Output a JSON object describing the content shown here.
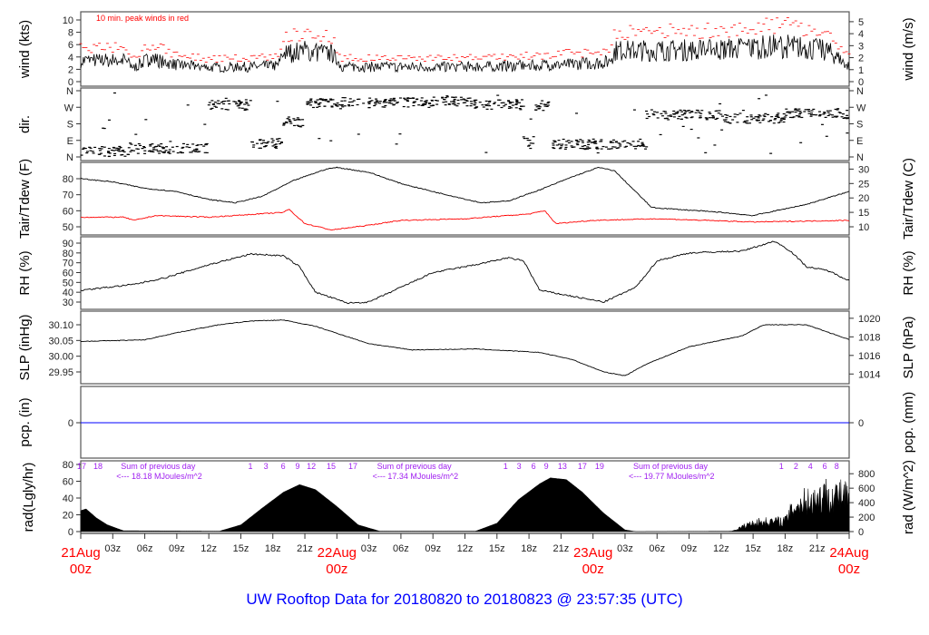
{
  "title": "UW Rooftop Data for 20180820  to  20180823 @ 23:57:35  (UTC)",
  "colors": {
    "title": "#0000ff",
    "peak": "#ff0000",
    "dew": "#ff0000",
    "pcp": "#0000ff",
    "day_label": "#ff0000",
    "rad_annot": "#a020f0"
  },
  "x_axis": {
    "start": "2018-08-21T00:00",
    "end": "2018-08-24T00:00",
    "hour_ticks": [
      "03z",
      "06z",
      "09z",
      "12z",
      "15z",
      "18z",
      "21z"
    ],
    "day_labels": [
      {
        "day": "21Aug",
        "hour": "00z"
      },
      {
        "day": "22Aug",
        "hour": "00z"
      },
      {
        "day": "23Aug",
        "hour": "00z"
      },
      {
        "day": "24Aug",
        "hour": "00z"
      }
    ]
  },
  "chart_data": [
    {
      "type": "line",
      "id": "wind",
      "ylabel": "wind (kts)",
      "ylabel_right": "wind (m/s)",
      "ylim": [
        0,
        10.5
      ],
      "yticks": [
        "0",
        "2",
        "4",
        "6",
        "8",
        "10"
      ],
      "yticks_right": [
        "0",
        "1",
        "2",
        "3",
        "4",
        "5"
      ],
      "annotation": "10 min. peak winds in red",
      "series": [
        {
          "role": "mean",
          "color": "#000000",
          "points": [
            [
              "2018-08-21T00:00",
              3.4
            ],
            [
              "2018-08-21T04:00",
              3.5
            ],
            [
              "2018-08-21T05:00",
              2.3
            ],
            [
              "2018-08-21T06:30",
              3.8
            ],
            [
              "2018-08-21T09:00",
              2.7
            ],
            [
              "2018-08-21T12:00",
              2.3
            ],
            [
              "2018-08-21T16:00",
              2.4
            ],
            [
              "2018-08-21T18:30",
              2.6
            ],
            [
              "2018-08-21T19:00",
              4.5
            ],
            [
              "2018-08-21T21:00",
              5.0
            ],
            [
              "2018-08-21T23:30",
              4.5
            ],
            [
              "2018-08-22T00:30",
              2.4
            ],
            [
              "2018-08-22T12:00",
              2.4
            ],
            [
              "2018-08-22T18:00",
              2.6
            ],
            [
              "2018-08-23T00:00",
              3.0
            ],
            [
              "2018-08-23T01:30",
              3.2
            ],
            [
              "2018-08-23T02:00",
              5.0
            ],
            [
              "2018-08-23T12:00",
              5.2
            ],
            [
              "2018-08-23T18:00",
              5.8
            ],
            [
              "2018-08-23T22:00",
              5.0
            ],
            [
              "2018-08-24T00:00",
              2.5
            ]
          ]
        },
        {
          "role": "10 min peak",
          "color": "#ff0000"
        }
      ]
    },
    {
      "type": "scatter",
      "id": "dir",
      "ylabel": "dir.",
      "yticks": [
        "N",
        "E",
        "S",
        "W",
        "N"
      ],
      "segments": [
        [
          "2018-08-21T00:00",
          "2018-08-21T04:30",
          30
        ],
        [
          "2018-08-21T04:30",
          "2018-08-21T05:30",
          45
        ],
        [
          "2018-08-21T05:30",
          "2018-08-21T12:00",
          45
        ],
        [
          "2018-08-21T12:00",
          "2018-08-21T16:00",
          280
        ],
        [
          "2018-08-21T16:00",
          "2018-08-21T19:00",
          75
        ],
        [
          "2018-08-21T19:00",
          "2018-08-21T21:00",
          190
        ],
        [
          "2018-08-21T21:00",
          "2018-08-22T09:00",
          295
        ],
        [
          "2018-08-22T09:00",
          "2018-08-22T12:30",
          305
        ],
        [
          "2018-08-22T12:30",
          "2018-08-22T14:00",
          290
        ],
        [
          "2018-08-22T14:00",
          "2018-08-22T17:30",
          285
        ],
        [
          "2018-08-22T17:30",
          "2018-08-22T18:30",
          85
        ],
        [
          "2018-08-22T18:30",
          "2018-08-22T20:00",
          280
        ],
        [
          "2018-08-22T20:00",
          "2018-08-23T05:00",
          70
        ],
        [
          "2018-08-23T05:00",
          "2018-08-23T12:00",
          230
        ],
        [
          "2018-08-23T12:00",
          "2018-08-23T18:00",
          210
        ],
        [
          "2018-08-23T18:00",
          "2018-08-24T00:00",
          235
        ]
      ]
    },
    {
      "type": "line",
      "id": "temp",
      "ylabel": "Tair/Tdew (F)",
      "ylabel_right": "Tair/Tdew (C)",
      "yticks": [
        "50",
        "60",
        "70",
        "80"
      ],
      "yticks_right": [
        "10",
        "15",
        "20",
        "25",
        "30"
      ],
      "series": [
        {
          "name": "Tair",
          "color": "#000000",
          "points": [
            [
              "2018-08-21T00:00",
              80
            ],
            [
              "2018-08-21T03:00",
              78
            ],
            [
              "2018-08-21T06:00",
              74
            ],
            [
              "2018-08-21T09:00",
              72
            ],
            [
              "2018-08-21T12:00",
              67
            ],
            [
              "2018-08-21T14:30",
              65
            ],
            [
              "2018-08-21T17:00",
              69
            ],
            [
              "2018-08-21T20:00",
              79
            ],
            [
              "2018-08-21T23:00",
              86
            ],
            [
              "2018-08-22T00:00",
              87
            ],
            [
              "2018-08-22T03:00",
              84
            ],
            [
              "2018-08-22T06:00",
              77
            ],
            [
              "2018-08-22T09:00",
              72
            ],
            [
              "2018-08-22T13:30",
              65
            ],
            [
              "2018-08-22T16:00",
              66
            ],
            [
              "2018-08-22T19:00",
              73
            ],
            [
              "2018-08-22T22:00",
              81
            ],
            [
              "2018-08-23T00:30",
              87
            ],
            [
              "2018-08-23T02:00",
              85
            ],
            [
              "2018-08-23T05:30",
              62
            ],
            [
              "2018-08-23T12:00",
              59
            ],
            [
              "2018-08-23T15:00",
              57
            ],
            [
              "2018-08-23T20:00",
              64
            ],
            [
              "2018-08-24T00:00",
              72
            ]
          ]
        },
        {
          "name": "Tdew",
          "color": "#ff0000",
          "points": [
            [
              "2018-08-21T00:00",
              56
            ],
            [
              "2018-08-21T04:00",
              56
            ],
            [
              "2018-08-21T05:00",
              54
            ],
            [
              "2018-08-21T07:00",
              57
            ],
            [
              "2018-08-21T12:00",
              56
            ],
            [
              "2018-08-21T19:00",
              59
            ],
            [
              "2018-08-21T19:30",
              61
            ],
            [
              "2018-08-21T21:00",
              52
            ],
            [
              "2018-08-21T23:30",
              48
            ],
            [
              "2018-08-22T03:00",
              51
            ],
            [
              "2018-08-22T06:00",
              54
            ],
            [
              "2018-08-22T12:00",
              55
            ],
            [
              "2018-08-22T18:00",
              58
            ],
            [
              "2018-08-22T19:30",
              60
            ],
            [
              "2018-08-22T20:30",
              52
            ],
            [
              "2018-08-23T00:00",
              54
            ],
            [
              "2018-08-23T06:00",
              55
            ],
            [
              "2018-08-23T15:00",
              53
            ],
            [
              "2018-08-24T00:00",
              54
            ]
          ]
        }
      ]
    },
    {
      "type": "line",
      "id": "rh",
      "ylabel": "RH (%)",
      "ylabel_right": "RH (%)",
      "yticks": [
        "30",
        "40",
        "50",
        "60",
        "70",
        "80",
        "90"
      ],
      "series": [
        {
          "color": "#000000",
          "points": [
            [
              "2018-08-21T00:00",
              42
            ],
            [
              "2018-08-21T05:00",
              48
            ],
            [
              "2018-08-21T08:00",
              55
            ],
            [
              "2018-08-21T12:00",
              68
            ],
            [
              "2018-08-21T16:00",
              79
            ],
            [
              "2018-08-21T19:00",
              77
            ],
            [
              "2018-08-21T20:30",
              66
            ],
            [
              "2018-08-21T22:00",
              40
            ],
            [
              "2018-08-22T01:00",
              29
            ],
            [
              "2018-08-22T03:00",
              30
            ],
            [
              "2018-08-22T06:00",
              45
            ],
            [
              "2018-08-22T09:00",
              60
            ],
            [
              "2018-08-22T13:00",
              68
            ],
            [
              "2018-08-22T16:00",
              75
            ],
            [
              "2018-08-22T17:30",
              72
            ],
            [
              "2018-08-22T19:00",
              42
            ],
            [
              "2018-08-22T21:00",
              38
            ],
            [
              "2018-08-23T01:00",
              30
            ],
            [
              "2018-08-23T04:00",
              45
            ],
            [
              "2018-08-23T06:00",
              72
            ],
            [
              "2018-08-23T09:00",
              80
            ],
            [
              "2018-08-23T14:00",
              82
            ],
            [
              "2018-08-23T17:00",
              92
            ],
            [
              "2018-08-23T18:30",
              82
            ],
            [
              "2018-08-23T20:00",
              66
            ],
            [
              "2018-08-23T22:00",
              62
            ],
            [
              "2018-08-24T00:00",
              52
            ]
          ]
        }
      ]
    },
    {
      "type": "line",
      "id": "slp",
      "ylabel": "SLP (inHg)",
      "ylabel_right": "SLP (hPa)",
      "yticks": [
        "29.95",
        "30.00",
        "30.05",
        "30.10"
      ],
      "yticks_right": [
        "1014",
        "1016",
        "1018",
        "1020"
      ],
      "series": [
        {
          "color": "#000000",
          "points": [
            [
              "2018-08-21T00:00",
              30.047
            ],
            [
              "2018-08-21T06:00",
              30.052
            ],
            [
              "2018-08-21T09:00",
              30.075
            ],
            [
              "2018-08-21T13:00",
              30.1
            ],
            [
              "2018-08-21T16:00",
              30.112
            ],
            [
              "2018-08-21T19:00",
              30.115
            ],
            [
              "2018-08-21T22:00",
              30.095
            ],
            [
              "2018-08-22T03:00",
              30.04
            ],
            [
              "2018-08-22T07:00",
              30.02
            ],
            [
              "2018-08-22T13:00",
              30.023
            ],
            [
              "2018-08-22T19:00",
              30.012
            ],
            [
              "2018-08-22T22:00",
              29.99
            ],
            [
              "2018-08-23T01:00",
              29.95
            ],
            [
              "2018-08-23T03:00",
              29.938
            ],
            [
              "2018-08-23T05:00",
              29.975
            ],
            [
              "2018-08-23T09:00",
              30.03
            ],
            [
              "2018-08-23T14:00",
              30.065
            ],
            [
              "2018-08-23T16:00",
              30.1
            ],
            [
              "2018-08-23T20:00",
              30.1
            ],
            [
              "2018-08-24T00:00",
              30.053
            ]
          ]
        }
      ]
    },
    {
      "type": "line",
      "id": "pcp",
      "ylabel": "pcp. (in)",
      "ylabel_right": "pcp. (mm)",
      "yticks": [
        "0"
      ],
      "yticks_right": [
        "0"
      ],
      "series": [
        {
          "color": "#0000ff",
          "points": [
            [
              "2018-08-21T00:00",
              0
            ],
            [
              "2018-08-24T00:00",
              0
            ]
          ]
        }
      ]
    },
    {
      "type": "area",
      "id": "rad",
      "ylabel": "rad(Lgly/hr)",
      "ylabel_right": "rad (W/m^2)",
      "yticks": [
        "0",
        "20",
        "40",
        "60",
        "80"
      ],
      "yticks_right": [
        "0",
        "200",
        "400",
        "600",
        "800"
      ],
      "series": [
        {
          "color": "#000000",
          "points": [
            [
              "2018-08-21T00:00",
              25
            ],
            [
              "2018-08-21T00:30",
              27
            ],
            [
              "2018-08-21T01:30",
              16
            ],
            [
              "2018-08-21T02:30",
              8
            ],
            [
              "2018-08-21T04:00",
              1
            ],
            [
              "2018-08-21T13:00",
              0.5
            ],
            [
              "2018-08-21T15:00",
              8
            ],
            [
              "2018-08-21T17:00",
              28
            ],
            [
              "2018-08-21T19:00",
              47
            ],
            [
              "2018-08-21T20:30",
              56
            ],
            [
              "2018-08-21T22:00",
              50
            ],
            [
              "2018-08-22T00:00",
              30
            ],
            [
              "2018-08-22T02:00",
              8
            ],
            [
              "2018-08-22T04:00",
              0.5
            ],
            [
              "2018-08-22T13:00",
              0.5
            ],
            [
              "2018-08-22T15:00",
              10
            ],
            [
              "2018-08-22T17:00",
              38
            ],
            [
              "2018-08-22T19:00",
              57
            ],
            [
              "2018-08-22T20:00",
              64
            ],
            [
              "2018-08-22T21:30",
              62
            ],
            [
              "2018-08-22T23:00",
              47
            ],
            [
              "2018-08-23T01:00",
              22
            ],
            [
              "2018-08-23T03:00",
              2
            ],
            [
              "2018-08-23T04:00",
              0
            ],
            [
              "2018-08-23T13:00",
              0.5
            ],
            [
              "2018-08-23T15:00",
              10
            ],
            [
              "2018-08-23T18:00",
              12
            ],
            [
              "2018-08-23T19:00",
              30
            ],
            [
              "2018-08-23T20:30",
              35
            ],
            [
              "2018-08-23T22:00",
              42
            ],
            [
              "2018-08-24T00:00",
              38
            ]
          ]
        }
      ],
      "daily_sums": [
        {
          "line1": "Sum of previous day",
          "line2": "<--- 18.18 MJoules/m^2",
          "time": "2018-08-21T03:00"
        },
        {
          "line1": "Sum of previous day",
          "line2": "<--- 17.34 MJoules/m^2",
          "time": "2018-08-22T03:00"
        },
        {
          "line1": "Sum of previous day",
          "line2": "<--- 19.77 MJoules/m^2",
          "time": "2018-08-23T03:00"
        }
      ],
      "hour_marks": [
        [
          "17",
          "2018-08-21T00:05"
        ],
        [
          "18",
          "2018-08-21T01:37"
        ],
        [
          "1",
          "2018-08-21T15:54"
        ],
        [
          "3",
          "2018-08-21T17:21"
        ],
        [
          "6",
          "2018-08-21T18:58"
        ],
        [
          "9",
          "2018-08-21T20:19"
        ],
        [
          "12",
          "2018-08-21T21:36"
        ],
        [
          "15",
          "2018-08-21T23:28"
        ],
        [
          "17",
          "2018-08-22T01:30"
        ],
        [
          "1",
          "2018-08-22T15:48"
        ],
        [
          "3",
          "2018-08-22T17:04"
        ],
        [
          "6",
          "2018-08-22T18:26"
        ],
        [
          "9",
          "2018-08-22T19:37"
        ],
        [
          "13",
          "2018-08-22T21:08"
        ],
        [
          "17",
          "2018-08-22T23:00"
        ],
        [
          "19",
          "2018-08-23T00:37"
        ],
        [
          "1",
          "2018-08-23T17:39"
        ],
        [
          "2",
          "2018-08-23T19:01"
        ],
        [
          "4",
          "2018-08-23T20:22"
        ],
        [
          "6",
          "2018-08-23T21:43"
        ],
        [
          "8",
          "2018-08-23T22:50"
        ]
      ]
    }
  ]
}
